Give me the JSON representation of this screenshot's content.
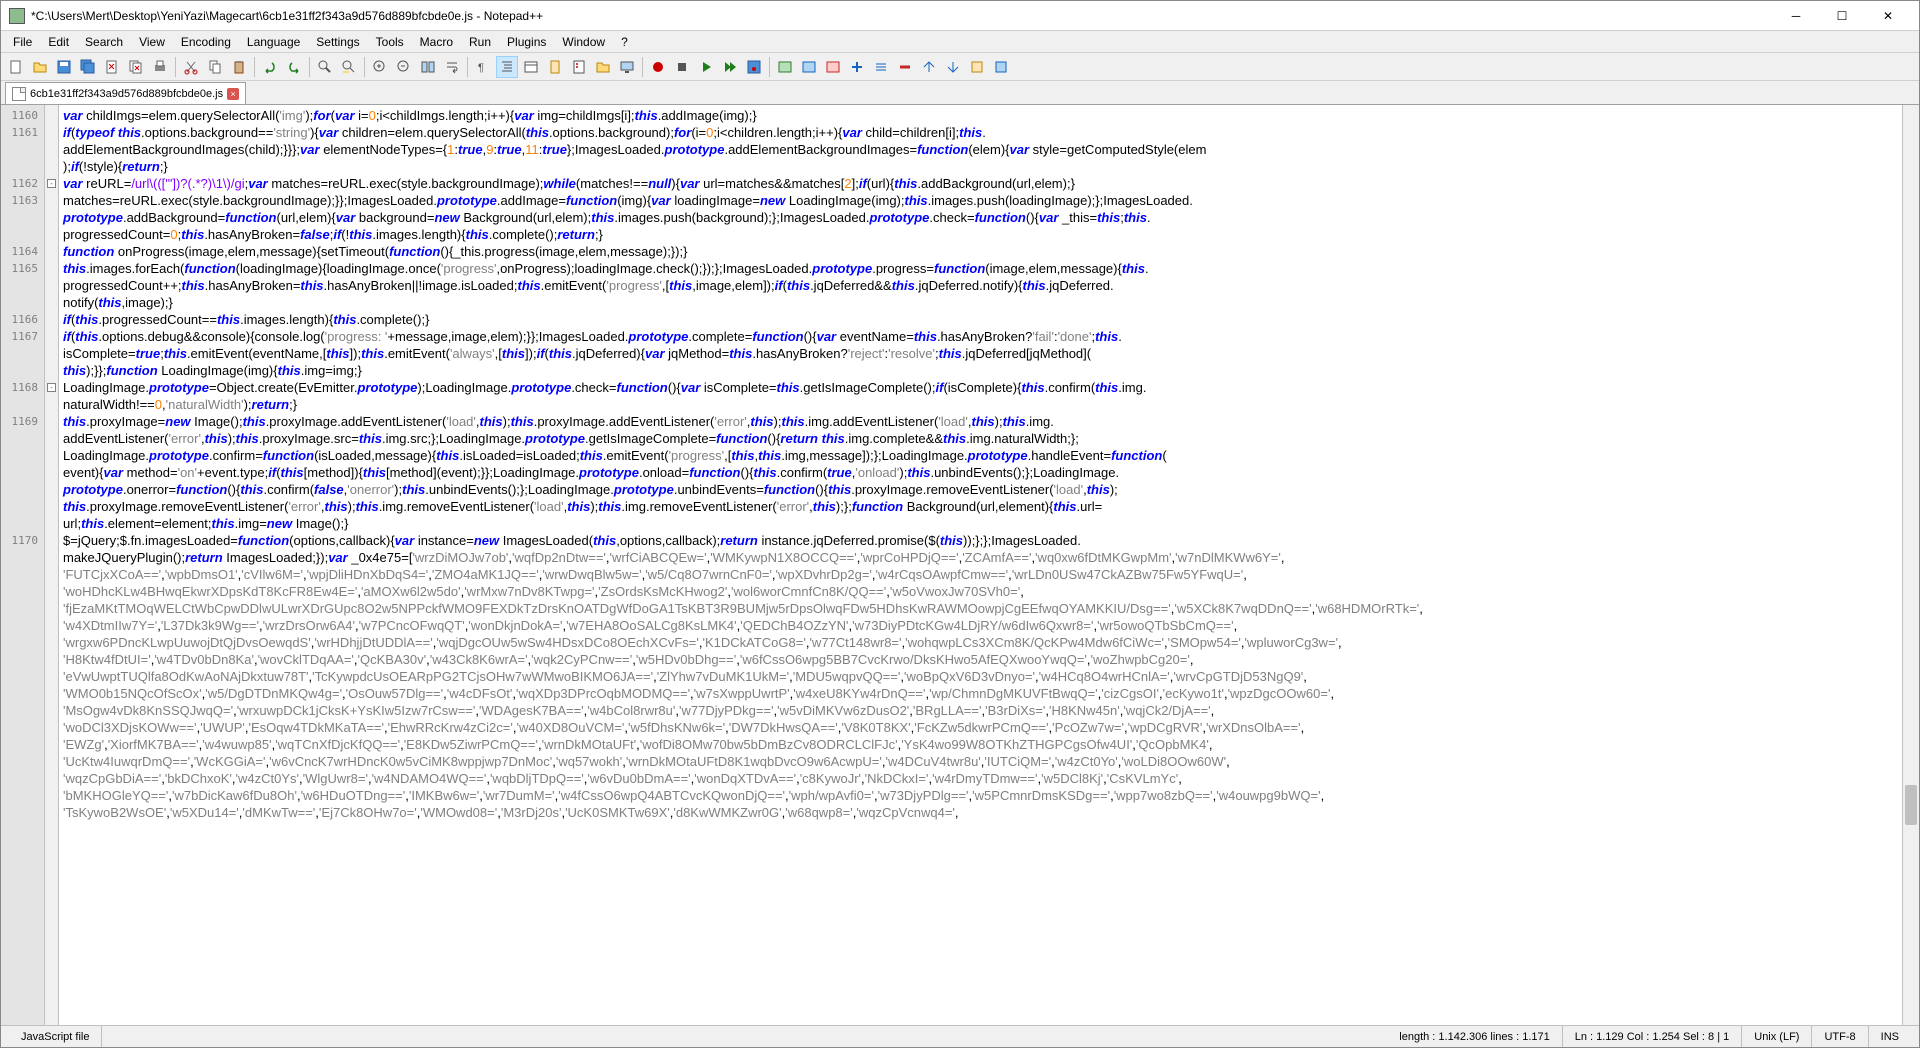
{
  "window": {
    "title": "*C:\\Users\\Mert\\Desktop\\YeniYazi\\Magecart\\6cb1e31ff2f343a9d576d889bfcbde0e.js - Notepad++"
  },
  "menu": {
    "items": [
      "File",
      "Edit",
      "Search",
      "View",
      "Encoding",
      "Language",
      "Settings",
      "Tools",
      "Macro",
      "Run",
      "Plugins",
      "Window",
      "?"
    ]
  },
  "tab": {
    "filename": "6cb1e31ff2f343a9d576d889bfcbde0e.js"
  },
  "lineNumbers": [
    1160,
    1161,
    "",
    1162,
    1163,
    "",
    1164,
    1165,
    "",
    1166,
    1167,
    "",
    1168,
    "",
    1169,
    "",
    "",
    "",
    "",
    1170
  ],
  "code": {
    "l1160": {
      "p": [
        "var",
        " childImgs=elem.querySelectorAll(",
        "'img'",
        ");",
        "for",
        "(",
        "var",
        " i=",
        "0",
        ";i<childImgs.length;i++){",
        "var",
        " img=childImgs[i];",
        "this",
        ".addImage(img);}"
      ]
    },
    "l1161a": {
      "p": [
        "if",
        "(",
        "typeof",
        " ",
        "this",
        ".options.background==",
        "'string'",
        "){",
        "var",
        " children=elem.querySelectorAll(",
        "this",
        ".options.background);",
        "for",
        "(i=",
        "0",
        ";i<children.length;i++){",
        "var",
        " child=children[i];",
        "this",
        "."
      ]
    },
    "l1161b": {
      "p": [
        "addElementBackgroundImages(child);}}};",
        "var",
        " elementNodeTypes={",
        "1",
        ":",
        "true",
        ",",
        "9",
        ":",
        "true",
        ",",
        "11",
        ":",
        "true",
        "};ImagesLoaded.",
        "prototype",
        ".addElementBackgroundImages=",
        "function",
        "(elem){",
        "var",
        " style=getComputedStyle(elem"
      ]
    },
    "l1161c": {
      "p": [
        ");",
        "if",
        "(!style){",
        "return",
        ";}"
      ]
    },
    "l1162": {
      "p": [
        "var",
        " reURL=",
        "/url\\((['\"])?(.*?)\\1\\)/gi",
        ";",
        "var",
        " matches=reURL.exec(style.backgroundImage);",
        "while",
        "(matches!==",
        "null",
        "){",
        "var",
        " url=matches&&matches[",
        "2",
        "];",
        "if",
        "(url){",
        "this",
        ".addBackground(url,elem);}"
      ]
    },
    "l1163a": {
      "p": [
        "matches=reURL.exec(style.backgroundImage);}};ImagesLoaded.",
        "prototype",
        ".addImage=",
        "function",
        "(img){",
        "var",
        " loadingImage=",
        "new",
        " LoadingImage(img);",
        "this",
        ".images.push(loadingImage);};ImagesLoaded."
      ]
    },
    "l1163b": {
      "p": [
        "prototype",
        ".addBackground=",
        "function",
        "(url,elem){",
        "var",
        " background=",
        "new",
        " Background(url,elem);",
        "this",
        ".images.push(background);};ImagesLoaded.",
        "prototype",
        ".check=",
        "function",
        "(){",
        "var",
        " _this=",
        "this",
        ";",
        "this",
        "."
      ]
    },
    "l1163c": {
      "p": [
        "progressedCount=",
        "0",
        ";",
        "this",
        ".hasAnyBroken=",
        "false",
        ";",
        "if",
        "(!",
        "this",
        ".images.length){",
        "this",
        ".complete();",
        "return",
        ";}"
      ]
    },
    "l1164": {
      "p": [
        "function",
        " onProgress(image,elem,message){setTimeout(",
        "function",
        "(){_this.progress(image,elem,message);});}"
      ]
    },
    "l1165a": {
      "p": [
        "this",
        ".images.forEach(",
        "function",
        "(loadingImage){loadingImage.once(",
        "'progress'",
        ",onProgress);loadingImage.check();});};ImagesLoaded.",
        "prototype",
        ".progress=",
        "function",
        "(image,elem,message){",
        "this",
        "."
      ]
    },
    "l1165b": {
      "p": [
        "progressedCount++;",
        "this",
        ".hasAnyBroken=",
        "this",
        ".hasAnyBroken||!image.isLoaded;",
        "this",
        ".emitEvent(",
        "'progress'",
        ",[",
        "this",
        ",image,elem]);",
        "if",
        "(",
        "this",
        ".jqDeferred&&",
        "this",
        ".jqDeferred.notify){",
        "this",
        ".jqDeferred."
      ]
    },
    "l1165c": {
      "p": [
        "notify(",
        "this",
        ",image);}"
      ]
    },
    "l1166": {
      "p": [
        "if",
        "(",
        "this",
        ".progressedCount==",
        "this",
        ".images.length){",
        "this",
        ".complete();}"
      ]
    },
    "l1167a": {
      "p": [
        "if",
        "(",
        "this",
        ".options.debug&&console){console.log(",
        "'progress: '",
        "+message,image,elem);}};ImagesLoaded.",
        "prototype",
        ".complete=",
        "function",
        "(){",
        "var",
        " eventName=",
        "this",
        ".hasAnyBroken?",
        "'fail'",
        ":",
        "'done'",
        ";",
        "this",
        "."
      ]
    },
    "l1167b": {
      "p": [
        "isComplete=",
        "true",
        ";",
        "this",
        ".emitEvent(eventName,[",
        "this",
        "]);",
        "this",
        ".emitEvent(",
        "'always'",
        ",[",
        "this",
        "]);",
        "if",
        "(",
        "this",
        ".jqDeferred){",
        "var",
        " jqMethod=",
        "this",
        ".hasAnyBroken?",
        "'reject'",
        ":",
        "'resolve'",
        ";",
        "this",
        ".jqDeferred[jqMethod]("
      ]
    },
    "l1167c": {
      "p": [
        "this",
        ");}};",
        "function",
        " LoadingImage(img){",
        "this",
        ".img=img;}"
      ]
    },
    "l1168a": {
      "p": [
        "LoadingImage.",
        "prototype",
        "=Object.create(EvEmitter.",
        "prototype",
        ");LoadingImage.",
        "prototype",
        ".check=",
        "function",
        "(){",
        "var",
        " isComplete=",
        "this",
        ".getIsImageComplete();",
        "if",
        "(isComplete){",
        "this",
        ".confirm(",
        "this",
        ".img."
      ]
    },
    "l1168b": {
      "p": [
        "naturalWidth!==",
        "0",
        ",",
        "'naturalWidth'",
        ");",
        "return",
        ";}"
      ]
    },
    "l1169a": {
      "p": [
        "this",
        ".proxyImage=",
        "new",
        " Image();",
        "this",
        ".proxyImage.addEventListener(",
        "'load'",
        ",",
        "this",
        ");",
        "this",
        ".proxyImage.addEventListener(",
        "'error'",
        ",",
        "this",
        ");",
        "this",
        ".img.addEventListener(",
        "'load'",
        ",",
        "this",
        ");",
        "this",
        ".img."
      ]
    },
    "l1169b": {
      "p": [
        "addEventListener(",
        "'error'",
        ",",
        "this",
        ");",
        "this",
        ".proxyImage.src=",
        "this",
        ".img.src;};LoadingImage.",
        "prototype",
        ".getIsImageComplete=",
        "function",
        "(){",
        "return",
        " ",
        "this",
        ".img.complete&&",
        "this",
        ".img.naturalWidth;};"
      ]
    },
    "l1169c": {
      "p": [
        "LoadingImage.",
        "prototype",
        ".confirm=",
        "function",
        "(isLoaded,message){",
        "this",
        ".isLoaded=isLoaded;",
        "this",
        ".emitEvent(",
        "'progress'",
        ",[",
        "this",
        ",",
        "this",
        ".img,message]);};LoadingImage.",
        "prototype",
        ".handleEvent=",
        "function",
        "("
      ]
    },
    "l1169d": {
      "p": [
        "event){",
        "var",
        " method=",
        "'on'",
        "+event.type;",
        "if",
        "(",
        "this",
        "[method]){",
        "this",
        "[method](event);}};LoadingImage.",
        "prototype",
        ".onload=",
        "function",
        "(){",
        "this",
        ".confirm(",
        "true",
        ",",
        "'onload'",
        ");",
        "this",
        ".unbindEvents();};LoadingImage."
      ]
    },
    "l1169e": {
      "p": [
        "prototype",
        ".onerror=",
        "function",
        "(){",
        "this",
        ".confirm(",
        "false",
        ",",
        "'onerror'",
        ");",
        "this",
        ".unbindEvents();};LoadingImage.",
        "prototype",
        ".unbindEvents=",
        "function",
        "(){",
        "this",
        ".proxyImage.removeEventListener(",
        "'load'",
        ",",
        "this",
        ");"
      ]
    },
    "l1169f": {
      "p": [
        "this",
        ".proxyImage.removeEventListener(",
        "'error'",
        ",",
        "this",
        ");",
        "this",
        ".img.removeEventListener(",
        "'load'",
        ",",
        "this",
        ");",
        "this",
        ".img.removeEventListener(",
        "'error'",
        ",",
        "this",
        ");};",
        "function",
        " Background(url,element){",
        "this",
        ".url="
      ]
    },
    "l1169g": {
      "p": [
        "url;",
        "this",
        ".element=element;",
        "this",
        ".img=",
        "new",
        " Image();}"
      ]
    },
    "l1170a": {
      "p": [
        "$=jQuery;$.fn.imagesLoaded=",
        "function",
        "(options,callback){",
        "var",
        " instance=",
        "new",
        " ImagesLoaded(",
        "this",
        ",options,callback);",
        "return",
        " instance.jqDeferred.promise($(",
        "this",
        "));};};ImagesLoaded."
      ]
    },
    "l1170b": {
      "p": [
        "makeJQueryPlugin();",
        "return",
        " ImagesLoaded;});",
        "var",
        " _0x4e75=[",
        "'wrzDiMOJw7ob'",
        ",",
        "'wqfDp2nDtw=='",
        ",",
        "'wrfCiABCQEw='",
        ",",
        "'WMKywpN1X8OCCQ=='",
        ",",
        "'wprCoHPDjQ=='",
        ",",
        "'ZCAmfA=='",
        ",",
        "'wq0xw6fDtMKGwpMm'",
        ",",
        "'w7nDlMKWw6Y='",
        ","
      ]
    },
    "l1170c": {
      "p": [
        "'FUTCjxXCoA=='",
        ",",
        "'wpbDmsO1'",
        ",",
        "'cVIlw6M='",
        ",",
        "'wpjDliHDnXbDqS4='",
        ",",
        "'ZMO4aMK1JQ=='",
        ",",
        "'wrwDwqBlw5w='",
        ",",
        "'w5/Cq8O7wrnCnF0='",
        ",",
        "'wpXDvhrDp2g='",
        ",",
        "'w4rCqsOAwpfCmw=='",
        ",",
        "'wrLDn0USw47CkAZBw75Fw5YFwqU='",
        ","
      ]
    },
    "l1170d": {
      "p": [
        "'woHDhcKLw4BHwqEkwrXDpsKdT8KcFR8Ew4E='",
        ",",
        "'aMOXw6l2w5do'",
        ",",
        "'wrMxw7nDv8KTwpg='",
        ",",
        "'ZsOrdsKsMcKHwog2'",
        ",",
        "'wol6worCmnfCn8K/QQ=='",
        ",",
        "'w5oVwoxJw70SVh0='",
        ","
      ]
    },
    "l1170e": {
      "p": [
        "'fjEzaMKtTMOqWELCtWbCpwDDlwULwrXDrGUpc8O2w5NPPckfWMO9FEXDkTzDrsKnOATDgWfDoGA1TsKBT3R9BUMjw5rDpsOlwqFDw5HDhsKwRAWMOowpjCgEEfwqOYAMKKIU/Dsg=='",
        ",",
        "'w5XCk8K7wqDDnQ=='",
        ",",
        "'w68HDMOrRTk='",
        ","
      ]
    },
    "l1170f": {
      "p": [
        "'w4XDtmIIw7Y='",
        ",",
        "'L37Dk3k9Wg=='",
        ",",
        "'wrzDrsOrw6A4'",
        ",",
        "'w7PCncOFwqQT'",
        ",",
        "'wonDkjnDokA='",
        ",",
        "'w7EHA8OoSALCg8KsLMK4'",
        ",",
        "'QEDChB4OZzYN'",
        ",",
        "'w73DiyPDtcKGw4LDjRY/w6dIw6Qxwr8='",
        ",",
        "'wr5owoQTbSbCmQ=='",
        ","
      ]
    },
    "l1170g": {
      "p": [
        "'wrgxw6PDncKLwpUuwojDtQjDvsOewqdS'",
        ",",
        "'wrHDhjjDtUDDlA=='",
        ",",
        "'wqjDgcOUw5wSw4HDsxDCo8OEchXCvFs='",
        ",",
        "'K1DCkATCoG8='",
        ",",
        "'w77Ct148wr8='",
        ",",
        "'wohqwpLCs3XCm8K/QcKPw4Mdw6fCiWc='",
        ",",
        "'SMOpw54='",
        ",",
        "'wpluworCg3w='",
        ","
      ]
    },
    "l1170h": {
      "p": [
        "'H8Ktw4fDtUI='",
        ",",
        "'w4TDv0bDn8Ka'",
        ",",
        "'wovCklTDqAA='",
        ",",
        "'QcKBA30v'",
        ",",
        "'w43Ck8K6wrA='",
        ",",
        "'wqk2CyPCnw=='",
        ",",
        "'w5HDv0bDhg=='",
        ",",
        "'w6fCssO6wpg5BB7CvcKrwo/DksKHwo5AfEQXwooYwqQ='",
        ",",
        "'woZhwpbCg20='",
        ","
      ]
    },
    "l1170i": {
      "p": [
        "'eVwUwptTUQlfa8OdKwAoNAjDkxtuw78T'",
        ",",
        "'TcKywpdcUsOEARpPG2TCjsOHw7wWMwoBIKMO6JA=='",
        ",",
        "'ZlYhw7vDuMK1UkM='",
        ",",
        "'MDU5wqpvQQ=='",
        ",",
        "'woBpQxV6D3vDnyo='",
        ",",
        "'w4HCq8O4wrHCnlA='",
        ",",
        "'wrvCpGTDjD53NgQ9'",
        ","
      ]
    },
    "l1170j": {
      "p": [
        "'WMO0b15NQcOfScOx'",
        ",",
        "'w5/DgDTDnMKQw4g='",
        ",",
        "'OsOuw57Dlg=='",
        ",",
        "'w4cDFsOt'",
        ",",
        "'wqXDp3DPrcOqbMODMQ=='",
        ",",
        "'w7sXwppUwrtP'",
        ",",
        "'w4xeU8KYw4rDnQ=='",
        ",",
        "'wp/ChmnDgMKUVFtBwqQ='",
        ",",
        "'cizCgsOI'",
        ",",
        "'ecKywo1t'",
        ",",
        "'wpzDgcOOw60='",
        ","
      ]
    },
    "l1170k": {
      "p": [
        "'MsOgw4vDk8KnSSQJwqQ='",
        ",",
        "'wrxuwpDCk1jCksK+YsKIw5Izw7rCsw=='",
        ",",
        "'WDAgesK7BA=='",
        ",",
        "'w4bCol8rwr8u'",
        ",",
        "'w77DjyPDkg=='",
        ",",
        "'w5vDiMKVw6zDusO2'",
        ",",
        "'BRgLLA=='",
        ",",
        "'B3rDiXs='",
        ",",
        "'H8KNw45n'",
        ",",
        "'wqjCk2/DjA=='",
        ","
      ]
    },
    "l1170l": {
      "p": [
        "'woDCl3XDjsKOWw=='",
        ",",
        "'UWUP'",
        ",",
        "'EsOqw4TDkMKaTA=='",
        ",",
        "'EhwRRcKrw4zCi2c='",
        ",",
        "'w40XD8OuVCM='",
        ",",
        "'w5fDhsKNw6k='",
        ",",
        "'DW7DkHwsQA=='",
        ",",
        "'V8K0T8KX'",
        ",",
        "'FcKZw5dkwrPCmQ=='",
        ",",
        "'PcOZw7w='",
        ",",
        "'wpDCgRVR'",
        ",",
        "'wrXDnsOlbA=='",
        ","
      ]
    },
    "l1170m": {
      "p": [
        "'EWZg'",
        ",",
        "'XiorfMK7BA=='",
        ",",
        "'w4wuwp85'",
        ",",
        "'wqTCnXfDjcKfQQ=='",
        ",",
        "'E8KDw5ZiwrPCmQ=='",
        ",",
        "'wrnDkMOtaUFt'",
        ",",
        "'wofDi8OMw70bw5bDmBzCv8ODRCLClFJc'",
        ",",
        "'YsK4wo99W8OTKhZTHGPCgsOfw4UI'",
        ",",
        "'QcOpbMK4'",
        ","
      ]
    },
    "l1170n": {
      "p": [
        "'UcKtw4IuwqrDmQ=='",
        ",",
        "'WcKGGiA='",
        ",",
        "'w6vCncK7wrHDncK0w5vCiMK8wppjwp7DnMoc'",
        ",",
        "'wq57wokh'",
        ",",
        "'wrnDkMOtaUFtD8K1wqbDvcO9w6AcwpU='",
        ",",
        "'w4DCuV4twr8u'",
        ",",
        "'IUTCiQM='",
        ",",
        "'w4zCt0Yo'",
        ",",
        "'woLDi8OOw60W'",
        ","
      ]
    },
    "l1170o": {
      "p": [
        "'wqzCpGbDiA=='",
        ",",
        "'bkDChxoK'",
        ",",
        "'w4zCt0Ys'",
        ",",
        "'WlgUwr8='",
        ",",
        "'w4NDAMO4WQ=='",
        ",",
        "'wqbDljTDpQ=='",
        ",",
        "'w6vDu0bDmA=='",
        ",",
        "'wonDqXTDvA=='",
        ",",
        "'c8KywoJr'",
        ",",
        "'NkDCkxI='",
        ",",
        "'w4rDmyTDmw=='",
        ",",
        "'w5DCl8Kj'",
        ",",
        "'CsKVLmYc'",
        ","
      ]
    },
    "l1170p": {
      "p": [
        "'bMKHOGleYQ=='",
        ",",
        "'w7bDicKaw6fDu8Oh'",
        ",",
        "'w6HDuOTDng=='",
        ",",
        "'IMKBw6w='",
        ",",
        "'wr7DumM='",
        ",",
        "'w4fCssO6wpQ4ABTCvcKQwonDjQ=='",
        ",",
        "'wph/wpAvfi0='",
        ",",
        "'w73DjyPDlg=='",
        ",",
        "'w5PCmnrDmsKSDg=='",
        ",",
        "'wpp7wo8zbQ=='",
        ",",
        "'w4ouwpg9bWQ='",
        ","
      ]
    },
    "l1170q": {
      "p": [
        "'TsKywoB2WsOE'",
        ",",
        "'w5XDu14='",
        ",",
        "'dMKwTw=='",
        ",",
        "'Ej7Ck8OHw7o='",
        ",",
        "'WMOwd08='",
        ",",
        "'M3rDj20s'",
        ",",
        "'UcK0SMKTw69X'",
        ",",
        "'d8KwWMKZwr0G'",
        ",",
        "'w68qwp8='",
        ",",
        "'wqzCpVcnwq4='",
        ","
      ]
    }
  },
  "status": {
    "lang": "JavaScript file",
    "length": "length : 1.142.306    lines : 1.171",
    "pos": "Ln : 1.129    Col : 1.254    Sel : 8 | 1",
    "eol": "Unix (LF)",
    "enc": "UTF-8",
    "ins": "INS"
  }
}
